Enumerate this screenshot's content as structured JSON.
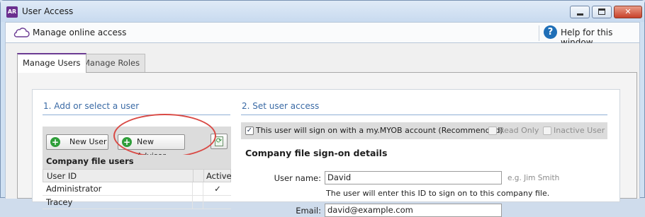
{
  "window": {
    "app_icon_text": "AR",
    "title": "User Access"
  },
  "toolbar": {
    "manage_online_label": "Manage online access",
    "help_label": "Help for this window"
  },
  "tabs": [
    {
      "label": "Manage Users",
      "active": true
    },
    {
      "label": "Manage Roles",
      "active": false
    }
  ],
  "section1": {
    "heading": "1. Add or select a user",
    "new_user_label": "New User",
    "new_advisor_label": "New Advisor",
    "company_file_users_label": "Company file users",
    "columns": {
      "user_id": "User ID",
      "active": "Active"
    },
    "rows": [
      {
        "name": "Administrator",
        "active": "✓"
      },
      {
        "name": "Tracey",
        "active": ""
      }
    ]
  },
  "section2": {
    "heading": "2. Set user access",
    "myob_checkbox_label": "This user will sign on with a my.MYOB account (Recommended)",
    "read_only_label": "Read Only",
    "inactive_user_label": "Inactive User",
    "signon_heading": "Company file sign-on details",
    "user_name_label": "User name:",
    "user_name_value": "David",
    "user_name_hint": "e.g. Jim Smith",
    "user_name_note": "The user will enter this ID to sign on to this company file.",
    "email_label": "Email:",
    "email_value": "david@example.com"
  },
  "colors": {
    "accent_purple": "#6b3b93",
    "section_heading_blue": "#3a6aa5",
    "highlight_red": "#d94a45",
    "add_green": "#2f9e3a",
    "help_blue": "#1f6fb7"
  },
  "icons": {
    "app": "app-logo-icon",
    "cloud": "cloud-icon",
    "help": "help-icon",
    "add": "plus-icon",
    "refresh": "refresh-icon",
    "check": "checkmark-icon"
  }
}
